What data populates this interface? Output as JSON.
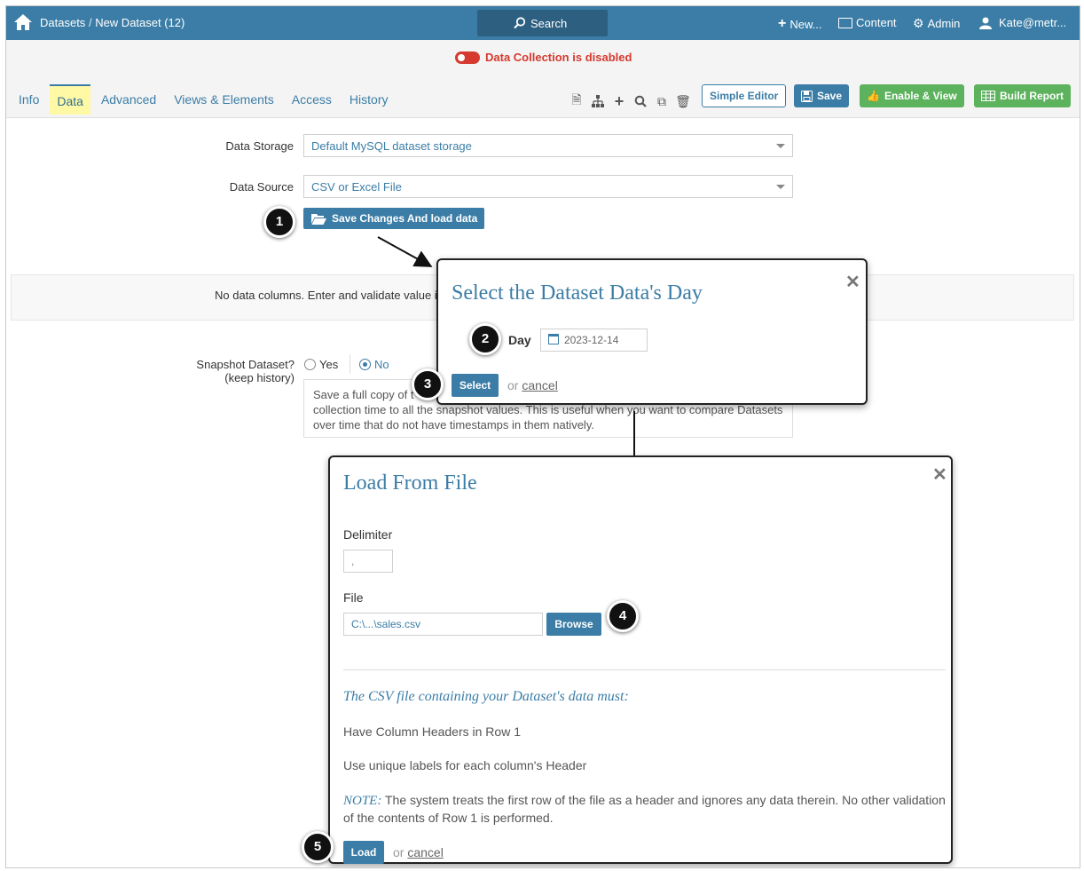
{
  "topbar": {
    "breadcrumb_root": "Datasets",
    "breadcrumb_sep": "/",
    "breadcrumb_current": "New Dataset (12)",
    "search_label": "Search",
    "new_label": "New...",
    "content_label": "Content",
    "admin_label": "Admin",
    "user_label": "Kate@metr..."
  },
  "status": {
    "data_collection": "Data Collection is disabled"
  },
  "tabs": [
    {
      "label": "Info"
    },
    {
      "label": "Data"
    },
    {
      "label": "Advanced"
    },
    {
      "label": "Views & Elements"
    },
    {
      "label": "Access"
    },
    {
      "label": "History"
    }
  ],
  "toolbar": {
    "simple_editor": "Simple Editor",
    "save": "Save",
    "enable_view": "Enable & View",
    "build_report": "Build Report"
  },
  "form": {
    "data_storage_label": "Data Storage",
    "data_storage_value": "Default MySQL dataset storage",
    "data_source_label": "Data Source",
    "data_source_value": "CSV or Excel File",
    "save_load_button": "Save Changes And load data",
    "no_data_text": "No data columns. Enter and validate value i",
    "snapshot_label": "Snapshot Dataset?",
    "snapshot_label2": "(keep history)",
    "snapshot_yes": "Yes",
    "snapshot_no": "No",
    "snapshot_desc_line1": "Save a full copy of t",
    "snapshot_desc_line2": "collection time to all the snapshot values. This is useful when you want to compare Datasets",
    "snapshot_desc_line3": "over time that do not have timestamps in them natively."
  },
  "day_dialog": {
    "title": "Select the Dataset Data's Day",
    "day_label": "Day",
    "day_value": "2023-12-14",
    "select_button": "Select",
    "or_text": "or",
    "cancel_text": "cancel"
  },
  "file_dialog": {
    "title": "Load From File",
    "delimiter_label": "Delimiter",
    "delimiter_value": ",",
    "file_label": "File",
    "file_value": "C:\\...\\sales.csv",
    "browse_button": "Browse",
    "requirements_heading": "The CSV file containing your Dataset's data must:",
    "req1": "Have Column Headers in Row 1",
    "req2": "Use unique labels for each column's Header",
    "note_label": "NOTE:",
    "note_text": " The system treats the first row of the file as a header and ignores any data therein. No other validation",
    "note_text2": "of the contents of Row 1 is performed.",
    "load_button": "Load",
    "or_text": "or",
    "cancel_text": "cancel"
  },
  "callouts": [
    "1",
    "2",
    "3",
    "4",
    "5"
  ],
  "colors": {
    "brand": "#3b7da6",
    "danger": "#d63a2f",
    "success": "#5cb25d",
    "tab_highlight": "#fff9a6"
  }
}
